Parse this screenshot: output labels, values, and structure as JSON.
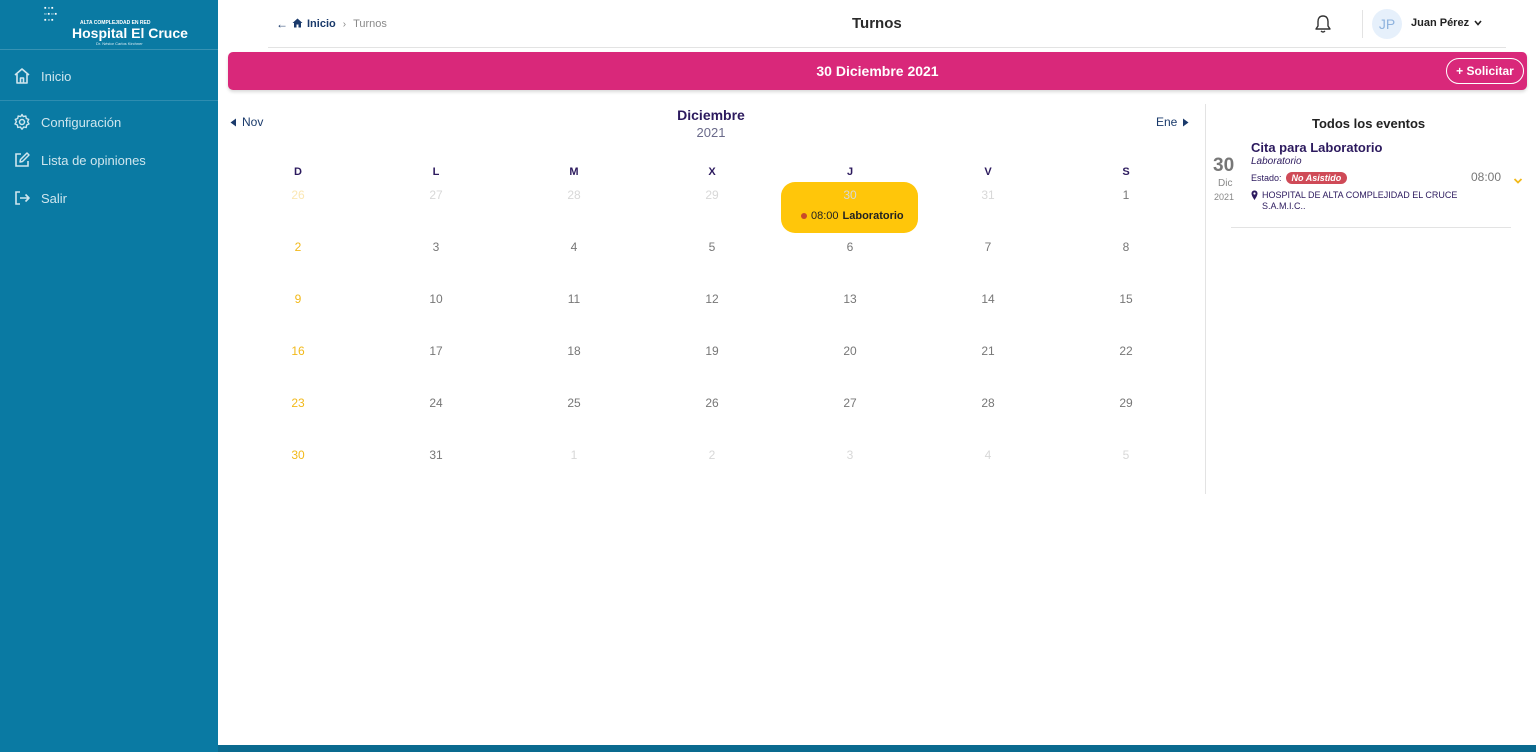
{
  "sidebar": {
    "logo": {
      "small": "ALTA COMPLEJIDAD EN RED",
      "main": "Hospital El Cruce",
      "sub": "Dr. Néstor Carlos Kirchner"
    },
    "items": [
      {
        "label": "Inicio",
        "icon": "home-icon"
      },
      {
        "label": "Configuración",
        "icon": "gear-icon"
      },
      {
        "label": "Lista de opiniones",
        "icon": "edit-icon"
      },
      {
        "label": "Salir",
        "icon": "logout-icon"
      }
    ]
  },
  "header": {
    "breadcrumb": {
      "home": "Inicio",
      "current": "Turnos"
    },
    "title": "Turnos",
    "user": {
      "initials": "JP",
      "name": "Juan Pérez"
    }
  },
  "datebar": {
    "title": "30 Diciembre 2021",
    "button": "+ Solicitar"
  },
  "calendar": {
    "prev": "Nov",
    "next": "Ene",
    "month": "Diciembre",
    "year": "2021",
    "weekdays": [
      "D",
      "L",
      "M",
      "X",
      "J",
      "V",
      "S"
    ],
    "weeks": [
      [
        "26",
        "27",
        "28",
        "29",
        "30",
        "31",
        "1"
      ],
      [
        "2",
        "3",
        "4",
        "5",
        "6",
        "7",
        "8"
      ],
      [
        "9",
        "10",
        "11",
        "12",
        "13",
        "14",
        "15"
      ],
      [
        "16",
        "17",
        "18",
        "19",
        "20",
        "21",
        "22"
      ],
      [
        "23",
        "24",
        "25",
        "26",
        "27",
        "28",
        "29"
      ],
      [
        "30",
        "31",
        "1",
        "2",
        "3",
        "4",
        "5"
      ]
    ],
    "event_chip": {
      "time": "08:00",
      "label": "Laboratorio"
    }
  },
  "events_panel": {
    "title": "Todos los eventos",
    "events": [
      {
        "day": "30",
        "month": "Dic",
        "year": "2021",
        "name": "Cita para Laboratorio",
        "type": "Laboratorio",
        "estado_label": "Estado:",
        "estado": "No Asistido",
        "location": "HOSPITAL DE ALTA COMPLEJIDAD EL CRUCE S.A.M.I.C..",
        "time": "08:00"
      }
    ]
  },
  "colors": {
    "sidebar": "#0a7aa3",
    "accent_pink": "#d9287a",
    "event_yellow": "#ffc60a",
    "sunday": "#f2b91a",
    "status_red": "#cf4a57"
  }
}
